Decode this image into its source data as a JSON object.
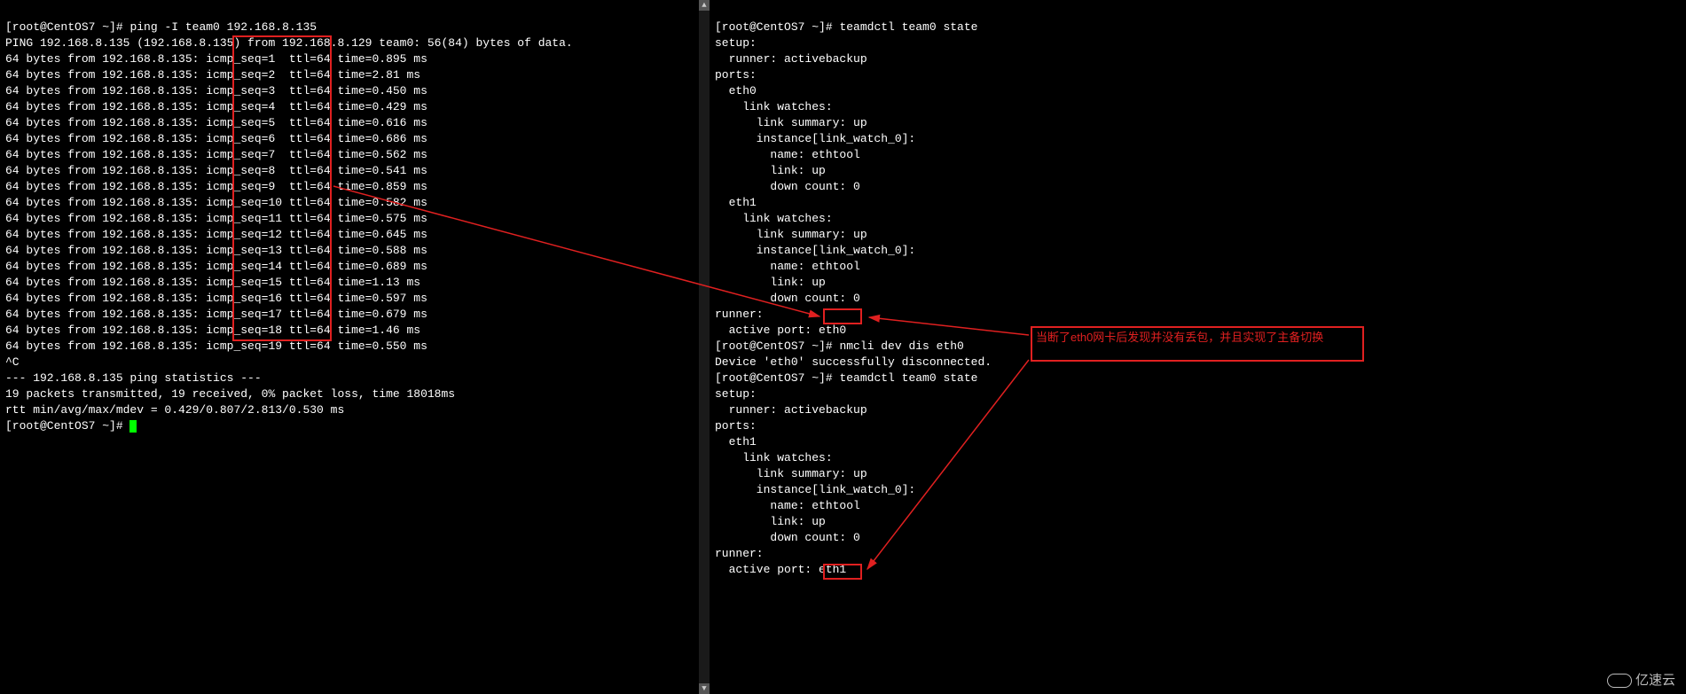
{
  "left": {
    "prompt1": "[root@CentOS7 ~]# ",
    "cmd1": "ping -I team0 192.168.8.135",
    "ping_header": "PING 192.168.8.135 (192.168.8.135) from 192.168.8.129 team0: 56(84) bytes of data.",
    "lines": [
      {
        "pre": "64 bytes from 192.168.8.135: ",
        "seq": "icmp_seq=1",
        "post": "  ttl=64 time=0.895 ms"
      },
      {
        "pre": "64 bytes from 192.168.8.135: ",
        "seq": "icmp_seq=2",
        "post": "  ttl=64 time=2.81 ms"
      },
      {
        "pre": "64 bytes from 192.168.8.135: ",
        "seq": "icmp_seq=3",
        "post": "  ttl=64 time=0.450 ms"
      },
      {
        "pre": "64 bytes from 192.168.8.135: ",
        "seq": "icmp_seq=4",
        "post": "  ttl=64 time=0.429 ms"
      },
      {
        "pre": "64 bytes from 192.168.8.135: ",
        "seq": "icmp_seq=5",
        "post": "  ttl=64 time=0.616 ms"
      },
      {
        "pre": "64 bytes from 192.168.8.135: ",
        "seq": "icmp_seq=6",
        "post": "  ttl=64 time=0.686 ms"
      },
      {
        "pre": "64 bytes from 192.168.8.135: ",
        "seq": "icmp_seq=7",
        "post": "  ttl=64 time=0.562 ms"
      },
      {
        "pre": "64 bytes from 192.168.8.135: ",
        "seq": "icmp_seq=8",
        "post": "  ttl=64 time=0.541 ms"
      },
      {
        "pre": "64 bytes from 192.168.8.135: ",
        "seq": "icmp_seq=9",
        "post": "  ttl=64 time=0.859 ms"
      },
      {
        "pre": "64 bytes from 192.168.8.135: ",
        "seq": "icmp_seq=10",
        "post": " ttl=64 time=0.582 ms"
      },
      {
        "pre": "64 bytes from 192.168.8.135: ",
        "seq": "icmp_seq=11",
        "post": " ttl=64 time=0.575 ms"
      },
      {
        "pre": "64 bytes from 192.168.8.135: ",
        "seq": "icmp_seq=12",
        "post": " ttl=64 time=0.645 ms"
      },
      {
        "pre": "64 bytes from 192.168.8.135: ",
        "seq": "icmp_seq=13",
        "post": " ttl=64 time=0.588 ms"
      },
      {
        "pre": "64 bytes from 192.168.8.135: ",
        "seq": "icmp_seq=14",
        "post": " ttl=64 time=0.689 ms"
      },
      {
        "pre": "64 bytes from 192.168.8.135: ",
        "seq": "icmp_seq=15",
        "post": " ttl=64 time=1.13 ms"
      },
      {
        "pre": "64 bytes from 192.168.8.135: ",
        "seq": "icmp_seq=16",
        "post": " ttl=64 time=0.597 ms"
      },
      {
        "pre": "64 bytes from 192.168.8.135: ",
        "seq": "icmp_seq=17",
        "post": " ttl=64 time=0.679 ms"
      },
      {
        "pre": "64 bytes from 192.168.8.135: ",
        "seq": "icmp_seq=18",
        "post": " ttl=64 time=1.46 ms"
      },
      {
        "pre": "64 bytes from 192.168.8.135: ",
        "seq": "icmp_seq=19",
        "post": " ttl=64 time=0.550 ms"
      }
    ],
    "interrupt": "^C",
    "stats_hdr": "--- 192.168.8.135 ping statistics ---",
    "stats1": "19 packets transmitted, 19 received, 0% packet loss, time 18018ms",
    "stats2": "rtt min/avg/max/mdev = 0.429/0.807/2.813/0.530 ms",
    "prompt2": "[root@CentOS7 ~]# "
  },
  "right": {
    "prompt1": "[root@CentOS7 ~]# ",
    "cmd1": "teamdctl team0 state",
    "block1": [
      "setup:",
      "  runner: activebackup",
      "ports:",
      "  eth0",
      "    link watches:",
      "      link summary: up",
      "      instance[link_watch_0]:",
      "        name: ethtool",
      "        link: up",
      "        down count: 0",
      "  eth1",
      "    link watches:",
      "      link summary: up",
      "      instance[link_watch_0]:",
      "        name: ethtool",
      "        link: up",
      "        down count: 0",
      "runner:"
    ],
    "active1_pre": "  active port: ",
    "active1_val": "eth0",
    "prompt2": "[root@CentOS7 ~]# ",
    "cmd2": "nmcli dev dis eth0",
    "disc": "Device 'eth0' successfully disconnected.",
    "prompt3": "[root@CentOS7 ~]# ",
    "cmd3": "teamdctl team0 state",
    "block2": [
      "setup:",
      "  runner: activebackup",
      "ports:",
      "  eth1",
      "    link watches:",
      "      link summary: up",
      "      instance[link_watch_0]:",
      "        name: ethtool",
      "        link: up",
      "        down count: 0",
      "runner:"
    ],
    "active2_pre": "  active port: ",
    "active2_val": "eth1"
  },
  "annotation": "当断了eth0网卡后发现并没有丢包，并且实现了主备切换",
  "watermark": "亿速云"
}
